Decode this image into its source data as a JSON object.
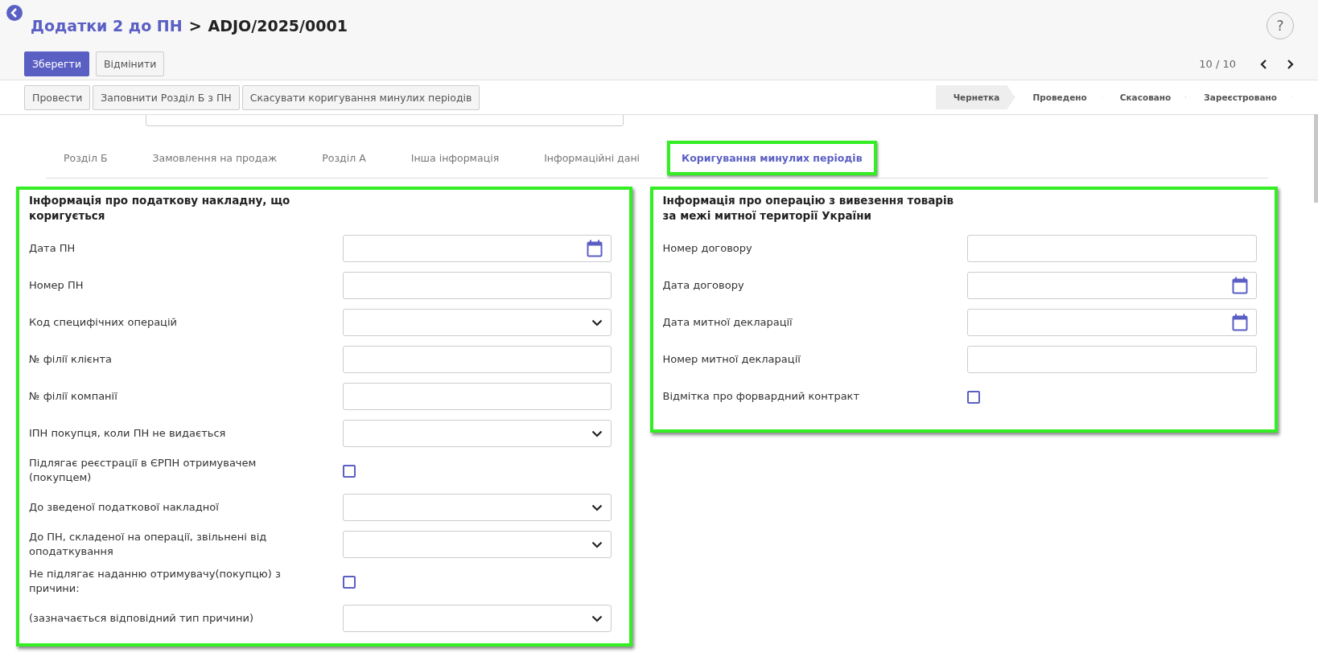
{
  "breadcrumb": {
    "parent": "Додатки 2 до ПН",
    "separator": ">",
    "current": "ADJO/2025/0001"
  },
  "buttons": [
    "Зберегти",
    "Відмінити"
  ],
  "help": "?",
  "pager": "10 / 10",
  "actions": [
    "Провести",
    "Заповнити Розділ Б з ПН",
    "Скасувати коригування минулих періодів"
  ],
  "stages": [
    {
      "label": "Чернетка",
      "selected": true
    },
    {
      "label": "Проведено",
      "selected": false
    },
    {
      "label": "Скасовано",
      "selected": false
    },
    {
      "label": "Зареєстровано",
      "selected": false
    }
  ],
  "tabs": [
    {
      "label": "Розділ Б",
      "selected": false
    },
    {
      "label": "Замовлення на продаж",
      "selected": false
    },
    {
      "label": "Розділ А",
      "selected": false
    },
    {
      "label": "Інша інформація",
      "selected": false
    },
    {
      "label": "Інформаційні дані",
      "selected": false
    },
    {
      "label": "Коригування минулих періодів",
      "selected": true
    }
  ],
  "panels": [
    {
      "title": "Інформація про податкову накладну, що коригується",
      "fields": [
        {
          "label": "Дата ПН",
          "kind": "date"
        },
        {
          "label": "Номер ПН",
          "kind": "text"
        },
        {
          "label": "Код специфічних операцій",
          "kind": "select"
        },
        {
          "label": "№ філії клієнта",
          "kind": "text"
        },
        {
          "label": "№ філії компанії",
          "kind": "text"
        },
        {
          "label": "ІПН покупця, коли ПН не видається",
          "kind": "select"
        },
        {
          "label": "Підлягає реєстрації в ЄРПН отримувачем (покупцем)",
          "kind": "checkbox",
          "checked": false
        },
        {
          "label": "До зведеної податкової накладної",
          "kind": "select"
        },
        {
          "label": "До ПН, складеної на операції, звільнені від оподаткування",
          "kind": "select"
        },
        {
          "label": "Не підлягає наданню отримувачу(покупцю) з причини:",
          "kind": "checkbox",
          "checked": false
        },
        {
          "label": "(зазначається відповідний тип причини)",
          "kind": "select"
        }
      ]
    },
    {
      "title": "Інформація про операцію з вивезення товарів за межі митної території України",
      "fields": [
        {
          "label": "Номер договору",
          "kind": "text"
        },
        {
          "label": "Дата договору",
          "kind": "date"
        },
        {
          "label": "Дата митної декларації",
          "kind": "date"
        },
        {
          "label": "Номер митної декларації",
          "kind": "text"
        },
        {
          "label": "Відмітка про форвардний контракт",
          "kind": "checkbox",
          "checked": false
        }
      ]
    }
  ]
}
